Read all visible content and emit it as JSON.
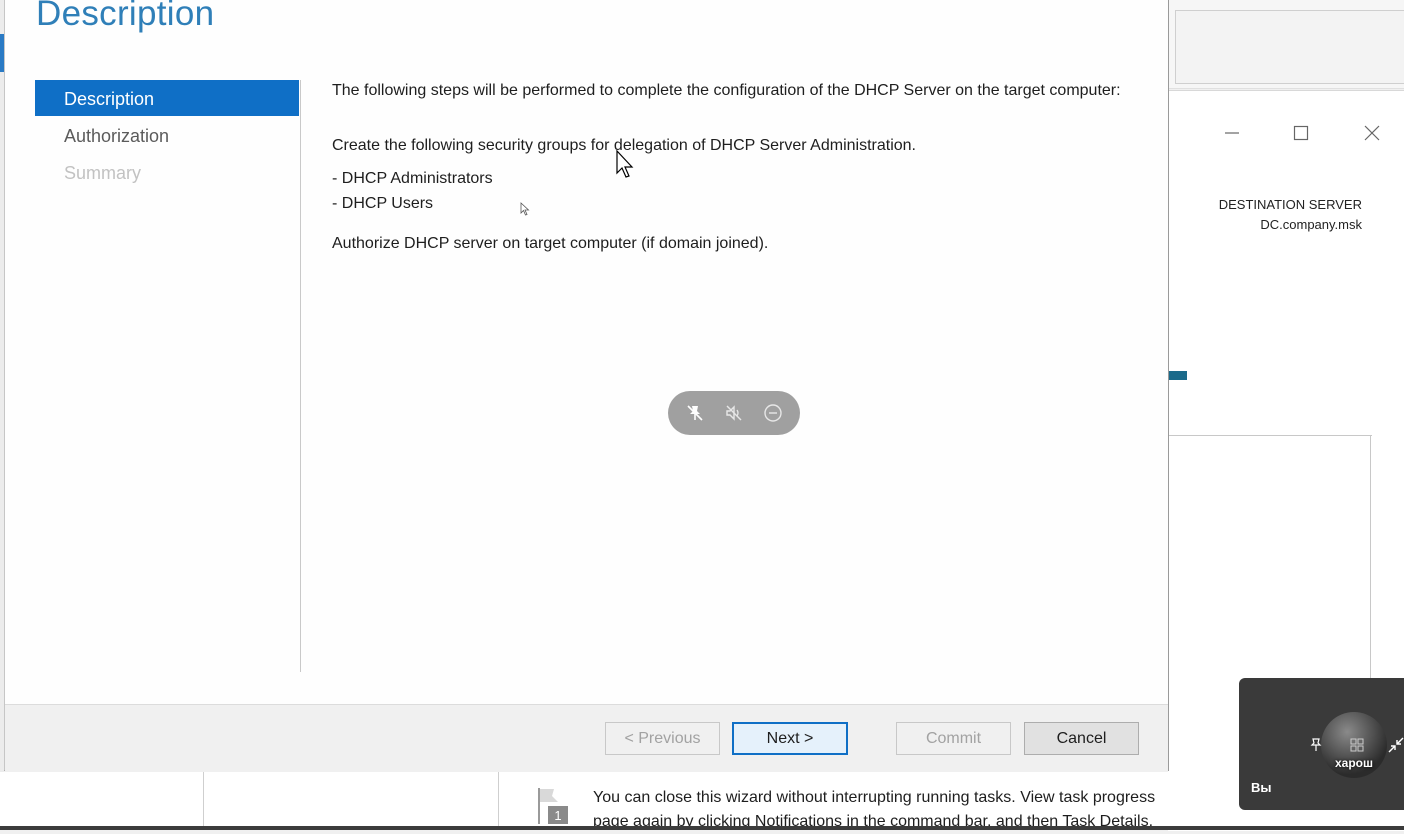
{
  "wizard": {
    "title": "Description",
    "nav": [
      {
        "label": "Description",
        "state": "active"
      },
      {
        "label": "Authorization",
        "state": "normal"
      },
      {
        "label": "Summary",
        "state": "disabled"
      }
    ],
    "content": {
      "intro": "The following steps will be performed to complete the configuration of the DHCP Server on the target computer:",
      "groups_title": "Create the following security groups for delegation of DHCP Server Administration.",
      "groups": [
        "- DHCP Administrators",
        "- DHCP Users"
      ],
      "authorize": "Authorize DHCP server on target computer (if domain joined)."
    },
    "buttons": {
      "previous": "< Previous",
      "next": "Next >",
      "commit": "Commit",
      "cancel": "Cancel"
    }
  },
  "background_window": {
    "destination_label": "DESTINATION SERVER",
    "destination_value": "DC.company.msk",
    "controls": [
      "minimize-icon",
      "maximize-icon",
      "close-icon"
    ],
    "note_line1": "You can close this wizard without interrupting running tasks. View task progress",
    "note_line2": "page again by clicking Notifications in the command bar, and then Task Details.",
    "flag_badge": "1"
  },
  "call_controls": {
    "icons": [
      "pin-off-icon",
      "mute-icon",
      "minus-circle-icon"
    ]
  },
  "video_tile": {
    "name": "Вы",
    "avatar_text": "харош"
  },
  "colors": {
    "accent": "#0f6fc6",
    "title": "#2f7fb8"
  }
}
